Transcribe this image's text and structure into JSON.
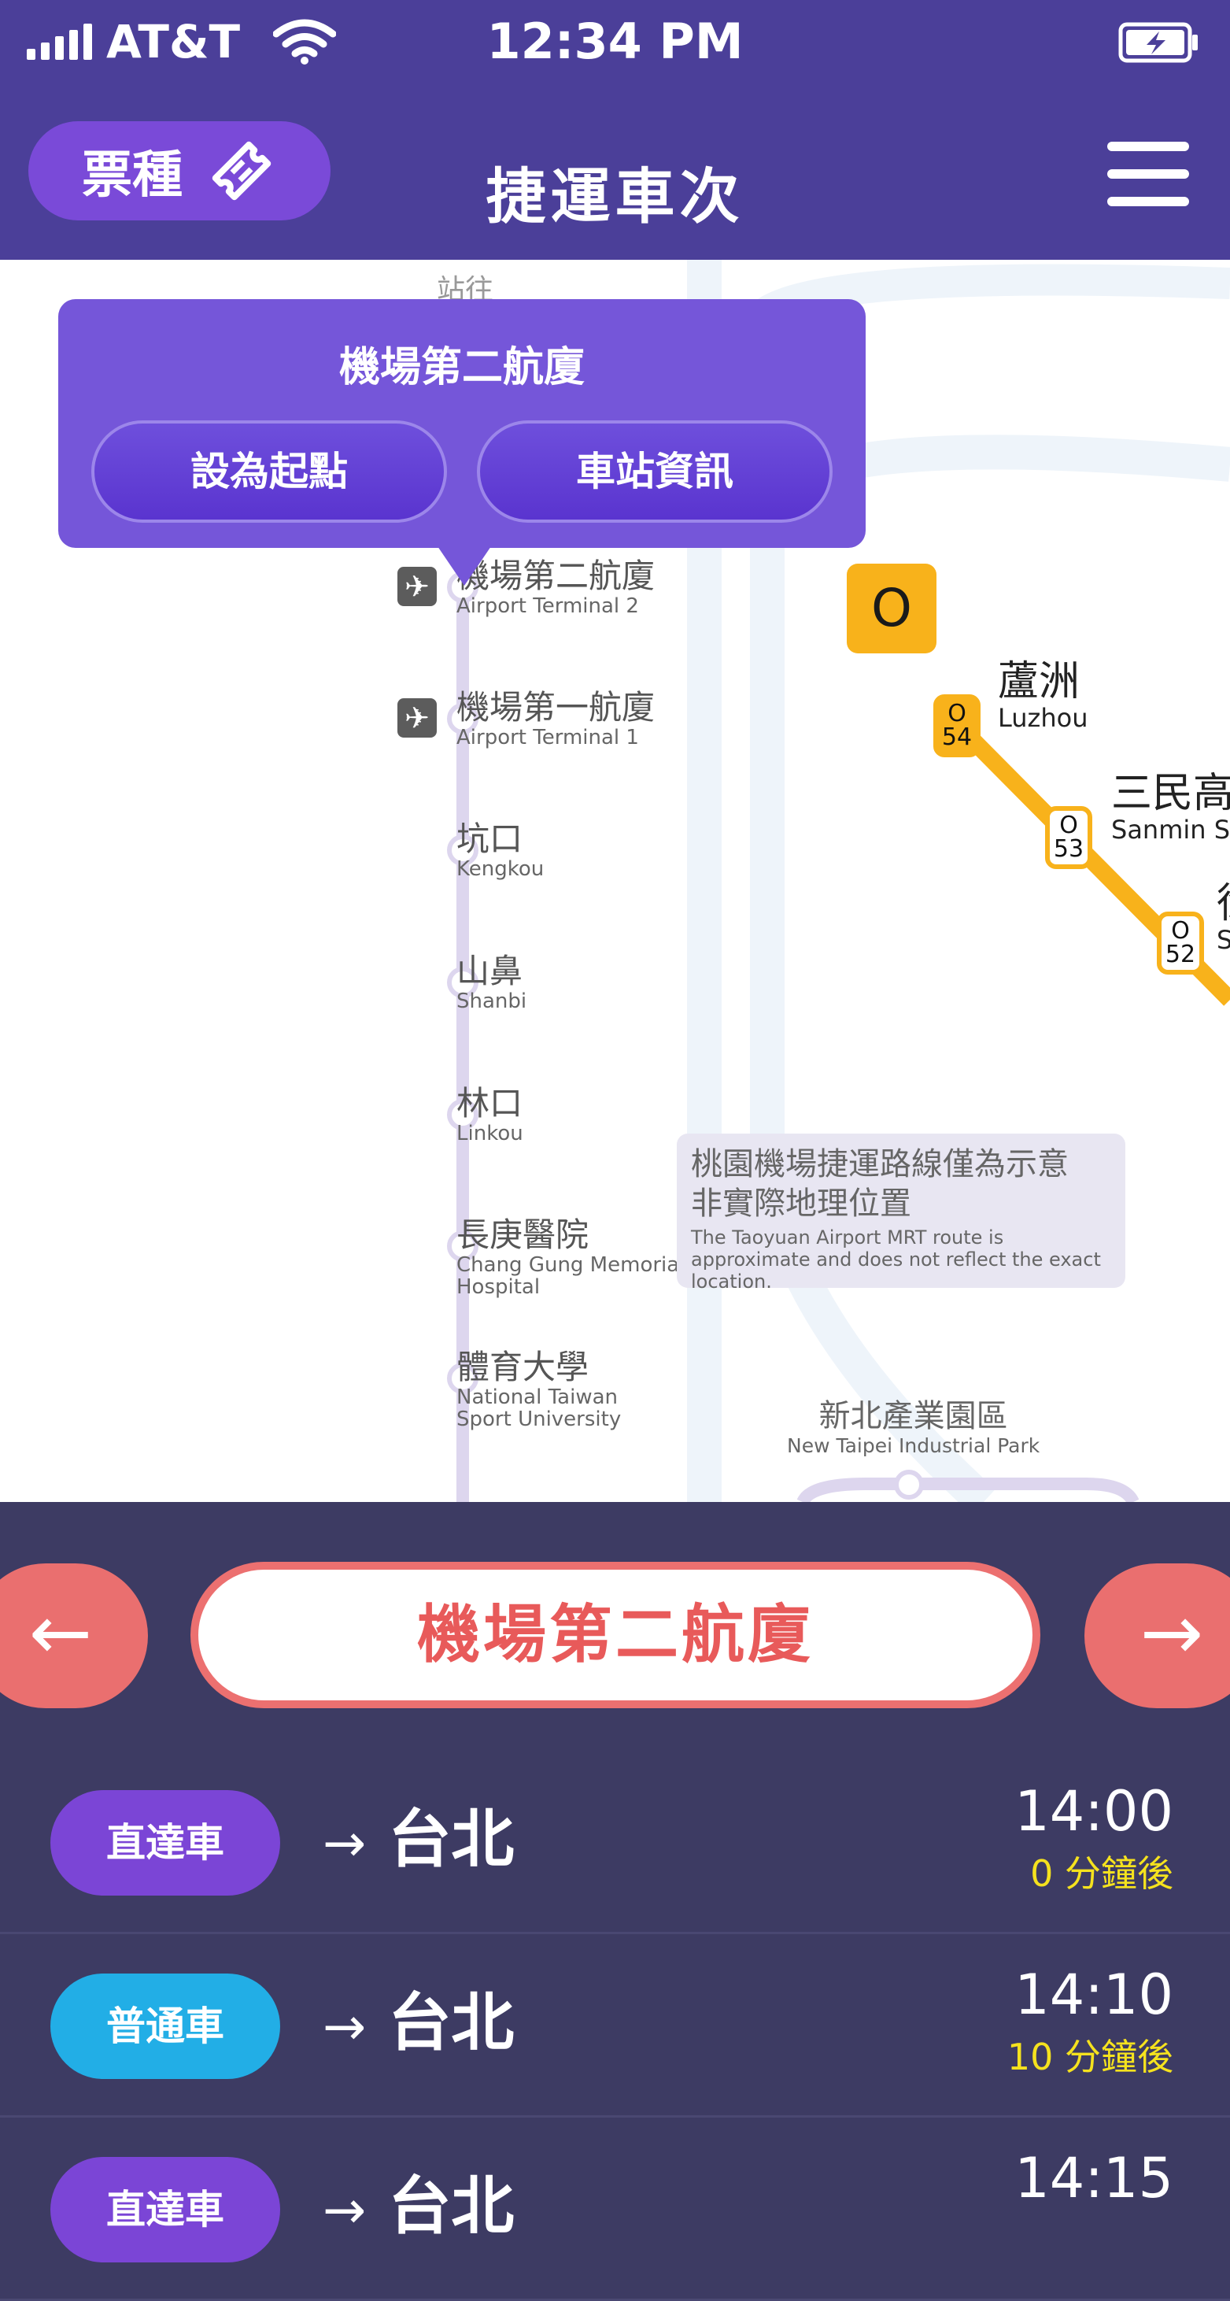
{
  "status_bar": {
    "carrier": "AT&T",
    "time": "12:34 PM"
  },
  "header": {
    "ticket_label": "票種",
    "title": "捷運車次"
  },
  "popup": {
    "title": "機場第二航廈",
    "set_origin": "設為起點",
    "station_info": "車站資訊"
  },
  "map": {
    "stations": [
      {
        "zh": "機場第二航廈",
        "en": "Airport Terminal 2",
        "airport": true
      },
      {
        "zh": "機場第一航廈",
        "en": "Airport Terminal 1",
        "airport": true
      },
      {
        "zh": "坑口",
        "en": "Kengkou",
        "airport": false
      },
      {
        "zh": "山鼻",
        "en": "Shanbi",
        "airport": false
      },
      {
        "zh": "林口",
        "en": "Linkou",
        "airport": false
      },
      {
        "zh": "長庚醫院",
        "en": "Chang Gung Memorial Hospital",
        "airport": false
      },
      {
        "zh": "體育大學",
        "en": "National Taiwan Sport University",
        "airport": false
      }
    ],
    "orange_line": {
      "badge": "O",
      "stops": [
        {
          "code_letter": "O",
          "code_num": "54",
          "zh": "蘆洲",
          "en": "Luzhou"
        },
        {
          "code_letter": "O",
          "code_num": "53",
          "zh": "三民高",
          "en": "Sanmin S"
        },
        {
          "code_letter": "O",
          "code_num": "52",
          "zh": "徐",
          "en": "S"
        }
      ]
    },
    "note": {
      "zh_line1": "桃園機場捷運路線僅為示意",
      "zh_line2": "非實際地理位置",
      "en": "The Taoyuan Airport MRT route is approximate and does not reflect the exact location."
    },
    "park": {
      "zh": "新北產業園區",
      "en": "New Taipei Industrial Park"
    },
    "colors": {
      "airport_line": "#ddd6ee",
      "orange_line": "#f8b21b",
      "background_line": "#eef4fa"
    }
  },
  "selector": {
    "station": "機場第二航廈",
    "prev_icon": "arrow-left-icon",
    "next_icon": "arrow-right-icon"
  },
  "trains": [
    {
      "type": "直達車",
      "color": "#7b45d6",
      "dest": "台北",
      "time": "14:00",
      "countdown": "0 分鐘後"
    },
    {
      "type": "普通車",
      "color": "#22aee6",
      "dest": "台北",
      "time": "14:10",
      "countdown": "10 分鐘後"
    },
    {
      "type": "直達車",
      "color": "#7b45d6",
      "dest": "台北",
      "time": "14:15",
      "countdown": ""
    }
  ]
}
